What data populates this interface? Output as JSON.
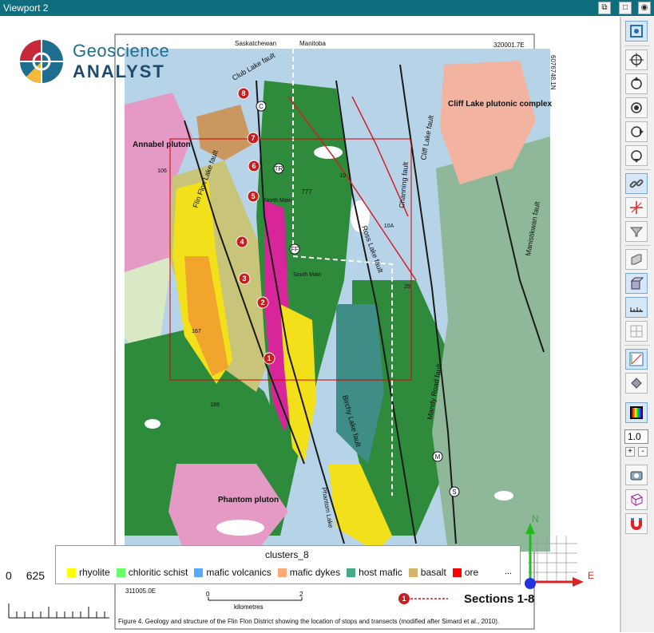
{
  "window": {
    "title": "Viewport 2"
  },
  "logo": {
    "line1": "Geoscience",
    "line2": "ANALYST"
  },
  "map": {
    "header_left": "Saskatchewan",
    "header_right": "Manitoba",
    "coord_top": "320001.7E",
    "coord_side": "6076748.1N",
    "coord_bottom": "311005.0E",
    "scale_min": "0",
    "scale_max": "2",
    "scale_unit": "kilometres",
    "sections_label": "Sections 1-8",
    "sections_marker": "1",
    "caption": "Figure 4. Geology and structure of the Flin Flon District showing the location of stops and transects (modified after Simard et al., 2010).",
    "labels": {
      "club_lake_fault": "Club Lake fault",
      "annabel": "Annabel\npluton",
      "flin_flon_fault": "Flin Flon Lake fault",
      "cliff_lake_fault": "Cliff Lake fault",
      "channing_fault": "Channing fault",
      "cliff_lake_complex": "Cliff Lake\nplutonic complex",
      "manistikwan_fault": "Manistikwan fault",
      "ross_lake_fault": "Ross Lake fault",
      "mandy_road_fault": "Mandy Road fault",
      "birch_lake_fault": "Birchy Lake fault",
      "phantom_pluton": "Phantom\npluton",
      "phantom_lake": "Phantom Lake",
      "north_main": "North Main",
      "south_main": "South Main"
    },
    "stops": [
      "8",
      "7",
      "6",
      "5",
      "4",
      "3",
      "2",
      "1"
    ],
    "road_labels": [
      "10",
      "10A",
      "106",
      "167",
      "188",
      "29"
    ],
    "site_labels": [
      "C",
      "TR",
      "FF",
      "M",
      "S",
      "777"
    ]
  },
  "legend": {
    "title": "clusters_8",
    "items": [
      {
        "label": "rhyolite",
        "color": "#ffff00"
      },
      {
        "label": "chloritic schist",
        "color": "#66ff66"
      },
      {
        "label": "mafic volcanics",
        "color": "#55aaff"
      },
      {
        "label": "mafic dykes",
        "color": "#ffaa77"
      },
      {
        "label": "host mafic",
        "color": "#44aa88"
      },
      {
        "label": "basalt",
        "color": "#d4b46a"
      },
      {
        "label": "ore",
        "color": "#ff0000"
      }
    ],
    "more": "..."
  },
  "scale_bar": {
    "start": "0",
    "tick": "625"
  },
  "axes": {
    "north": "N",
    "east": "E"
  },
  "toolbar": {
    "zoom_value": "1.0",
    "plus": "+",
    "minus": "-"
  }
}
